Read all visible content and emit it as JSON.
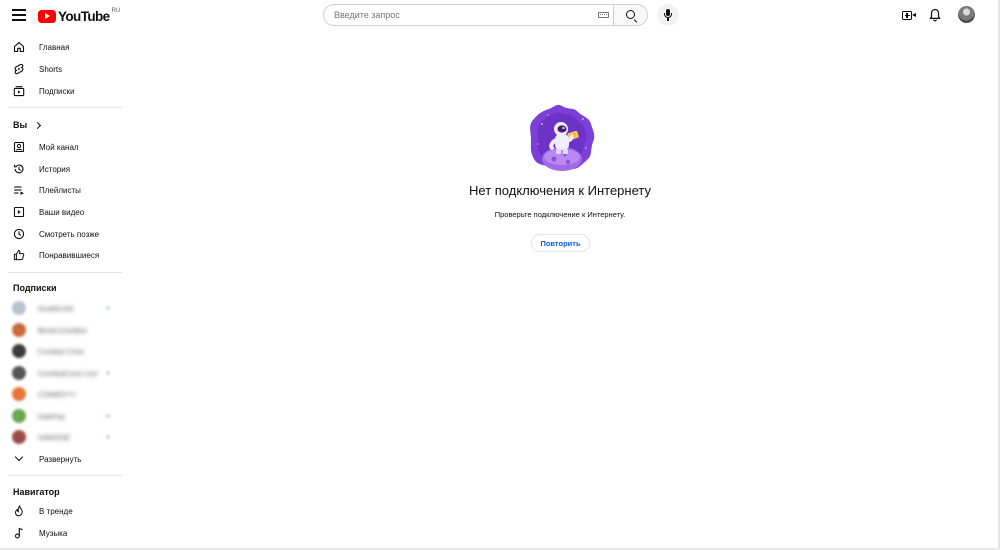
{
  "header": {
    "logo_text": "YouTube",
    "logo_region": "RU",
    "search_placeholder": "Введите запрос",
    "colors": {
      "brand_red": "#ff0000",
      "link_blue": "#065fd4"
    }
  },
  "sidebar": {
    "main_items": [
      {
        "label": "Главная",
        "icon": "home-icon"
      },
      {
        "label": "Shorts",
        "icon": "shorts-icon"
      },
      {
        "label": "Подписки",
        "icon": "subscriptions-icon"
      }
    ],
    "you_section": {
      "title": "Вы",
      "items": [
        {
          "label": "Мой канал",
          "icon": "channel-icon"
        },
        {
          "label": "История",
          "icon": "history-icon"
        },
        {
          "label": "Плейлисты",
          "icon": "playlists-icon"
        },
        {
          "label": "Ваши видео",
          "icon": "your-videos-icon"
        },
        {
          "label": "Смотреть позже",
          "icon": "watch-later-icon"
        },
        {
          "label": "Понравившиеся",
          "icon": "liked-icon"
        }
      ]
    },
    "subscriptions_section": {
      "title": "Подписки",
      "channels": [
        {
          "name": "Acadenvid",
          "color": "#b9c3d0"
        },
        {
          "name": "BestComedian",
          "color": "#c96b3a"
        },
        {
          "name": "Combat Crew",
          "color": "#3b3b3b"
        },
        {
          "name": "CombatCrew Live",
          "color": "#555555"
        },
        {
          "name": "COMEDYY",
          "color": "#e8743b"
        },
        {
          "name": "DabPop",
          "color": "#6aa84f"
        },
        {
          "name": "HAWSSE",
          "color": "#9b4a4a"
        }
      ],
      "expand_label": "Развернуть"
    },
    "navigator_section": {
      "title": "Навигатор",
      "items": [
        {
          "label": "В тренде",
          "icon": "trending-icon"
        },
        {
          "label": "Музыка",
          "icon": "music-icon"
        }
      ]
    }
  },
  "main": {
    "offline_title": "Нет подключения к Интернету",
    "offline_subtitle": "Проверьте подключение к Интернету.",
    "retry_label": "Повторить"
  }
}
